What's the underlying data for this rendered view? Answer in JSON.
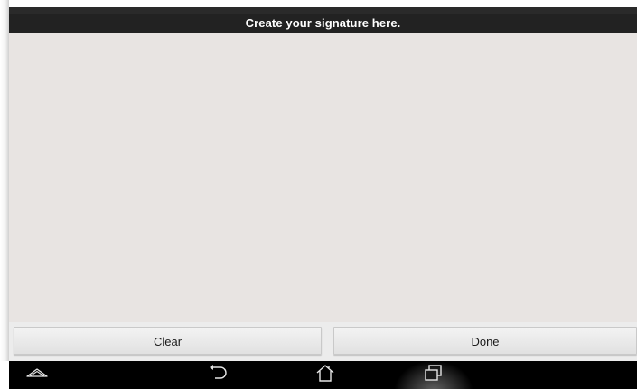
{
  "header": {
    "title": "Create your signature here."
  },
  "signature_pad": {
    "background_color": "#e8e4e2"
  },
  "actions": {
    "clear_label": "Clear",
    "done_label": "Done"
  },
  "system_nav": {
    "items": [
      {
        "icon": "menu-chevron-icon"
      },
      {
        "icon": "back-icon"
      },
      {
        "icon": "home-icon"
      },
      {
        "icon": "recent-apps-icon",
        "pressed": true
      }
    ]
  }
}
